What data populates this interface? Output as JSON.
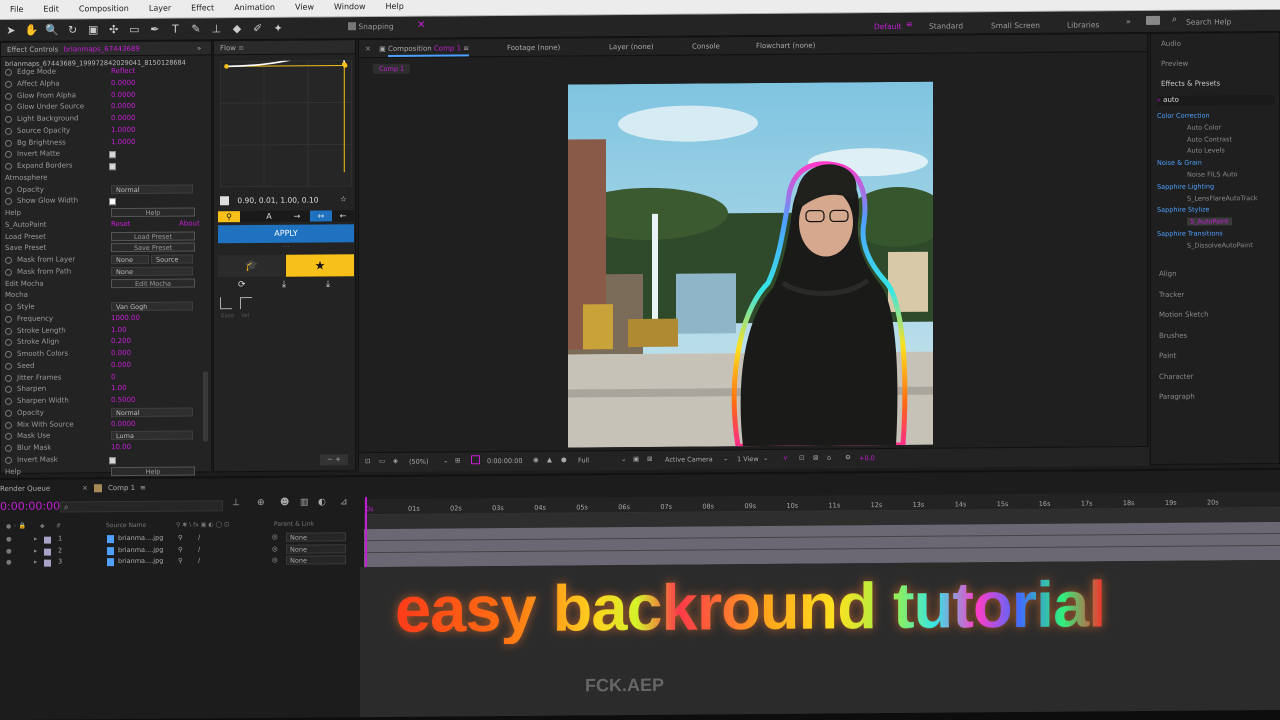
{
  "menu": [
    "File",
    "Edit",
    "Composition",
    "Layer",
    "Effect",
    "Animation",
    "View",
    "Window",
    "Help"
  ],
  "toolbar": {
    "snapping": "Snapping",
    "workspaces": [
      "Default",
      "Standard",
      "Small Screen",
      "Libraries"
    ],
    "search_placeholder": "Search Help"
  },
  "effect_controls": {
    "tab": "Effect Controls",
    "layer_name": "brianmaps_67443689",
    "file_path": "brianmaps_67443689_199972842029041_8150128684",
    "rows": [
      {
        "label": "Edge Mode",
        "kind": "value",
        "value": "Reflect"
      },
      {
        "label": "Affect Alpha",
        "kind": "value",
        "value": "0.0000"
      },
      {
        "label": "Glow From Alpha",
        "kind": "value",
        "value": "0.0000"
      },
      {
        "label": "Glow Under Source",
        "kind": "value",
        "value": "0.0000"
      },
      {
        "label": "Light Background",
        "kind": "value",
        "value": "0.0000"
      },
      {
        "label": "Source Opacity",
        "kind": "value",
        "value": "1.0000"
      },
      {
        "label": "Bg Brightness",
        "kind": "value",
        "value": "1.0000"
      },
      {
        "label": "Invert Matte",
        "kind": "check",
        "value": ""
      },
      {
        "label": "Expand Borders",
        "kind": "check",
        "value": ""
      },
      {
        "label": "Atmosphere",
        "kind": "group",
        "value": ""
      },
      {
        "label": "Opacity",
        "kind": "dropdown",
        "value": "Normal"
      },
      {
        "label": "Show Glow Width",
        "kind": "checked",
        "value": ""
      },
      {
        "label": "Help",
        "kind": "button",
        "value": "Help"
      },
      {
        "label": "S_AutoPaint",
        "kind": "reset",
        "value": "Reset"
      },
      {
        "label": "Load Preset",
        "kind": "button",
        "value": "Load Preset"
      },
      {
        "label": "Save Preset",
        "kind": "button",
        "value": "Save Preset"
      },
      {
        "label": "Mask from Layer",
        "kind": "dropdown",
        "value": "None"
      },
      {
        "label": "Mask from Path",
        "kind": "dropdown",
        "value": "None"
      },
      {
        "label": "Edit Mocha",
        "kind": "button",
        "value": "Edit Mocha"
      },
      {
        "label": "Mocha",
        "kind": "group",
        "value": ""
      },
      {
        "label": "Style",
        "kind": "dropdown",
        "value": "Van Gogh"
      },
      {
        "label": "Frequency",
        "kind": "value",
        "value": "1000.00"
      },
      {
        "label": "Stroke Length",
        "kind": "value",
        "value": "1.00"
      },
      {
        "label": "Stroke Align",
        "kind": "value",
        "value": "0.200"
      },
      {
        "label": "Smooth Colors",
        "kind": "value",
        "value": "0.000"
      },
      {
        "label": "Seed",
        "kind": "value",
        "value": "0.000"
      },
      {
        "label": "Jitter Frames",
        "kind": "value",
        "value": "0"
      },
      {
        "label": "Sharpen",
        "kind": "value",
        "value": "1.00"
      },
      {
        "label": "Sharpen Width",
        "kind": "value",
        "value": "0.5000"
      },
      {
        "label": "Opacity",
        "kind": "dropdown",
        "value": "Normal"
      },
      {
        "label": "Mix With Source",
        "kind": "value",
        "value": "0.0000"
      },
      {
        "label": "Mask Use",
        "kind": "dropdown",
        "value": "Luma"
      },
      {
        "label": "Blur Mask",
        "kind": "value",
        "value": "10.00"
      },
      {
        "label": "Invert Mask",
        "kind": "check",
        "value": ""
      },
      {
        "label": "Help",
        "kind": "button",
        "value": "Help"
      }
    ],
    "source_dropdown": "Source",
    "about_link": "About"
  },
  "flow": {
    "tab": "Flow",
    "curve_values": "0.90, 0.01, 1.00, 0.10",
    "apply_label": "APPLY",
    "small_labels": [
      "Ease",
      "Vel"
    ],
    "progress": {
      "p1": [
        0.02,
        0.99
      ],
      "p2": [
        0.97,
        1.0
      ],
      "p3": [
        0.88,
        0.0
      ]
    }
  },
  "composition": {
    "tab": "Composition",
    "comp_name": "Comp 1",
    "other_tabs": [
      "Footage (none)",
      "Layer (none)",
      "Console",
      "Flowchart (none)"
    ],
    "breadcrumb": "Comp 1",
    "footer": {
      "zoom": "(50%)",
      "timecode": "0:00:00:00",
      "resolution": "Full",
      "camera": "Active Camera",
      "view": "1 View",
      "offset": "+0.0"
    }
  },
  "right_panel": {
    "top": [
      "Audio",
      "Preview",
      "Effects & Presets"
    ],
    "search_value": "auto",
    "tree": [
      {
        "label": "Color Correction",
        "kind": "folder"
      },
      {
        "label": "Auto Color",
        "kind": "item"
      },
      {
        "label": "Auto Contrast",
        "kind": "item"
      },
      {
        "label": "Auto Levels",
        "kind": "item"
      },
      {
        "label": "Noise & Grain",
        "kind": "folder"
      },
      {
        "label": "Noise FILS Auto",
        "kind": "item"
      },
      {
        "label": "Sapphire Lighting",
        "kind": "folder"
      },
      {
        "label": "S_LensFlareAutoTrack",
        "kind": "item"
      },
      {
        "label": "Sapphire Stylize",
        "kind": "folder"
      },
      {
        "label": "S_AutoPaint",
        "kind": "selected"
      },
      {
        "label": "Sapphire Transitions",
        "kind": "folder"
      },
      {
        "label": "S_DissolveAutoPaint",
        "kind": "item"
      }
    ],
    "bottom": [
      "Align",
      "Tracker",
      "Motion Sketch",
      "Brushes",
      "Paint",
      "Character",
      "Paragraph"
    ]
  },
  "timeline": {
    "tabs": [
      "Render Queue",
      "Comp 1"
    ],
    "timecode": "0:00:00:00",
    "headers": {
      "source": "Source Name",
      "parent": "Parent & Link"
    },
    "layers": [
      {
        "num": "1",
        "name": "brianma....jpg",
        "parent": "None"
      },
      {
        "num": "2",
        "name": "brianma....jpg",
        "parent": "None"
      },
      {
        "num": "3",
        "name": "brianma....jpg",
        "parent": "None"
      }
    ],
    "ticks": [
      "0s",
      "01s",
      "02s",
      "03s",
      "04s",
      "05s",
      "06s",
      "07s",
      "08s",
      "09s",
      "10s",
      "11s",
      "12s",
      "13s",
      "14s",
      "15s",
      "16s",
      "17s",
      "18s",
      "19s",
      "20s"
    ]
  },
  "overlay": {
    "title": "easy backround tutorial",
    "watermark": "FCK.AEP"
  },
  "colors": {
    "accent_magenta": "#c41ed4",
    "flow_blue": "#1e72c0",
    "flow_yellow": "#f7c11a"
  }
}
